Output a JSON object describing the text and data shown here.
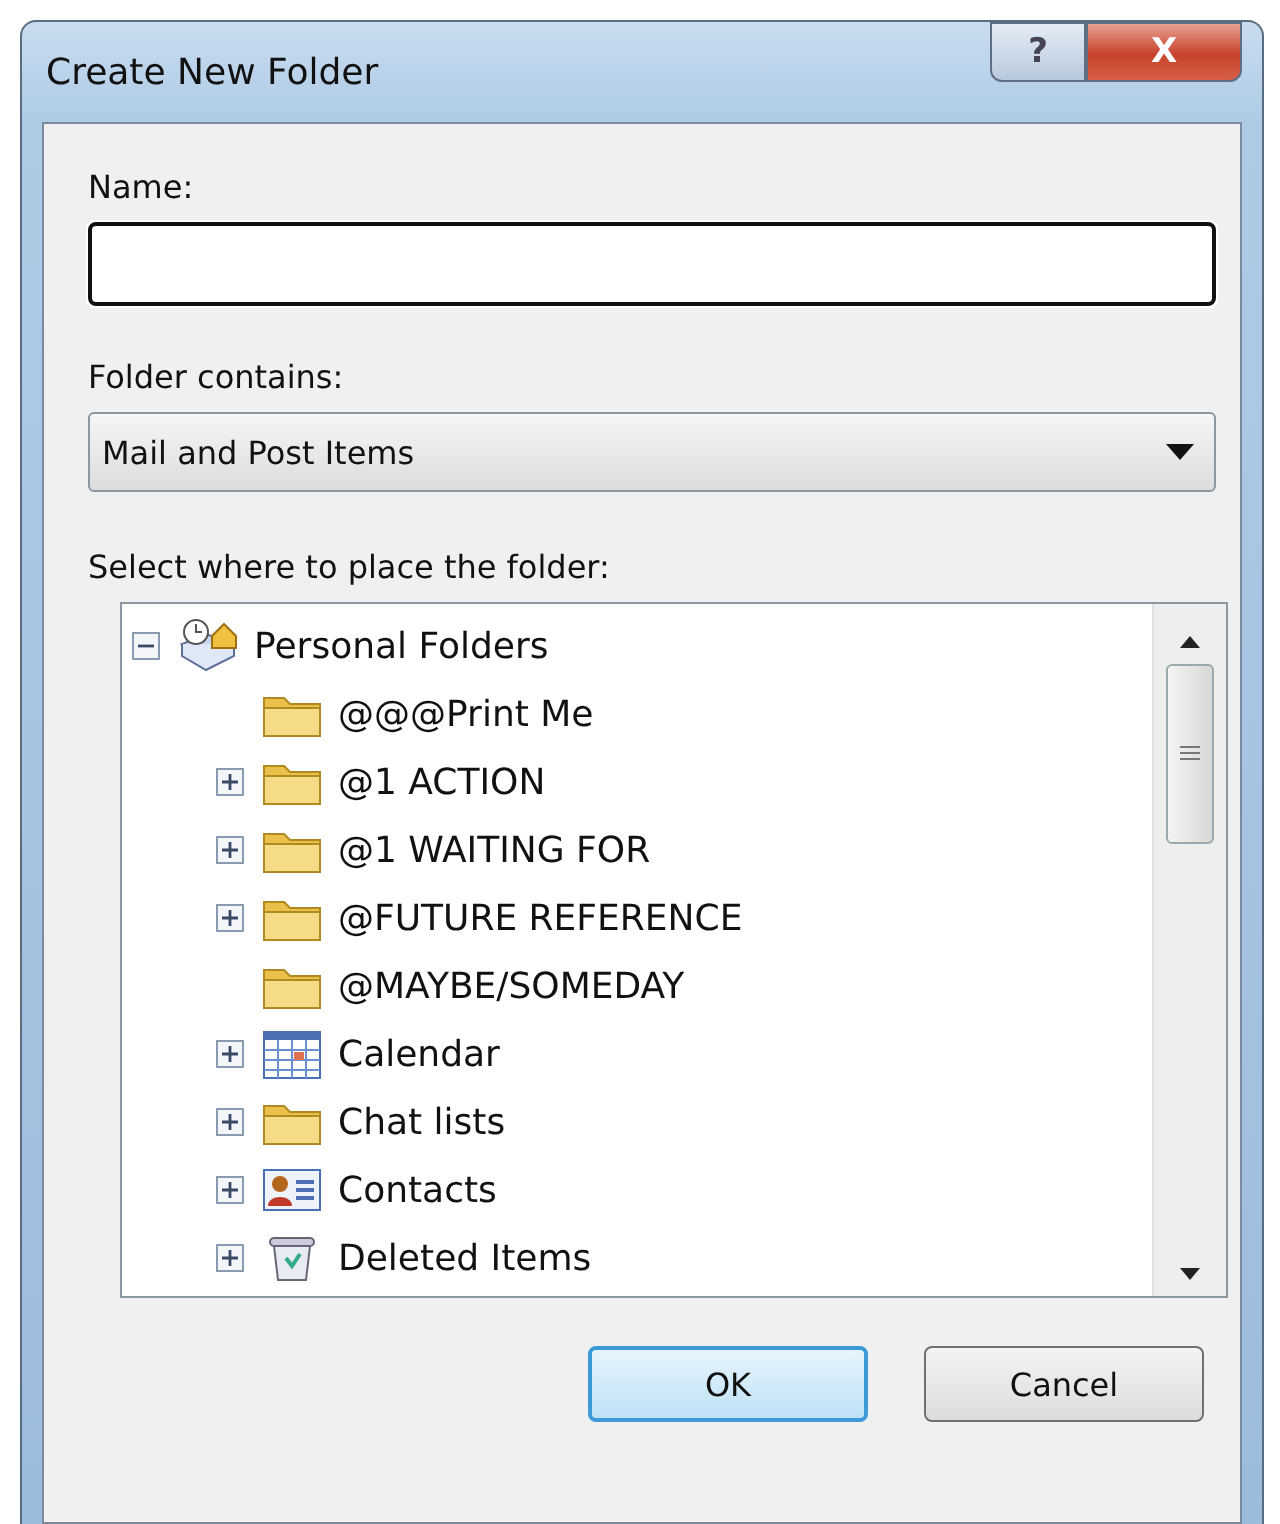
{
  "window": {
    "title": "Create New Folder",
    "controls": [
      {
        "kind": "help",
        "label": "?"
      },
      {
        "kind": "close",
        "label": "X"
      }
    ]
  },
  "name_field": {
    "label": "Name:"
  },
  "folder_contains": {
    "label": "Folder contains:",
    "value": "Mail and Post Items"
  },
  "location": {
    "label": "Select where to place the folder:",
    "tree": [
      {
        "label": "Personal Folders",
        "kind": "root",
        "expandable": true,
        "expanded": true,
        "children": [
          {
            "label": "@@@Print Me",
            "kind": "folder",
            "expandable": false
          },
          {
            "label": "@1 ACTION",
            "kind": "folder",
            "expandable": true
          },
          {
            "label": "@1 WAITING FOR",
            "kind": "folder",
            "expandable": true
          },
          {
            "label": "@FUTURE REFERENCE",
            "kind": "folder",
            "expandable": true
          },
          {
            "label": "@MAYBE/SOMEDAY",
            "kind": "folder",
            "expandable": false
          },
          {
            "label": "Calendar",
            "kind": "calendar",
            "expandable": true
          },
          {
            "label": "Chat lists",
            "kind": "folder",
            "expandable": true
          },
          {
            "label": "Contacts",
            "kind": "contacts",
            "expandable": true
          },
          {
            "label": "Deleted Items",
            "kind": "deleted",
            "expandable": true
          }
        ]
      }
    ]
  },
  "buttons": [
    {
      "label": "OK",
      "default": true
    },
    {
      "label": "Cancel",
      "default": false
    }
  ]
}
